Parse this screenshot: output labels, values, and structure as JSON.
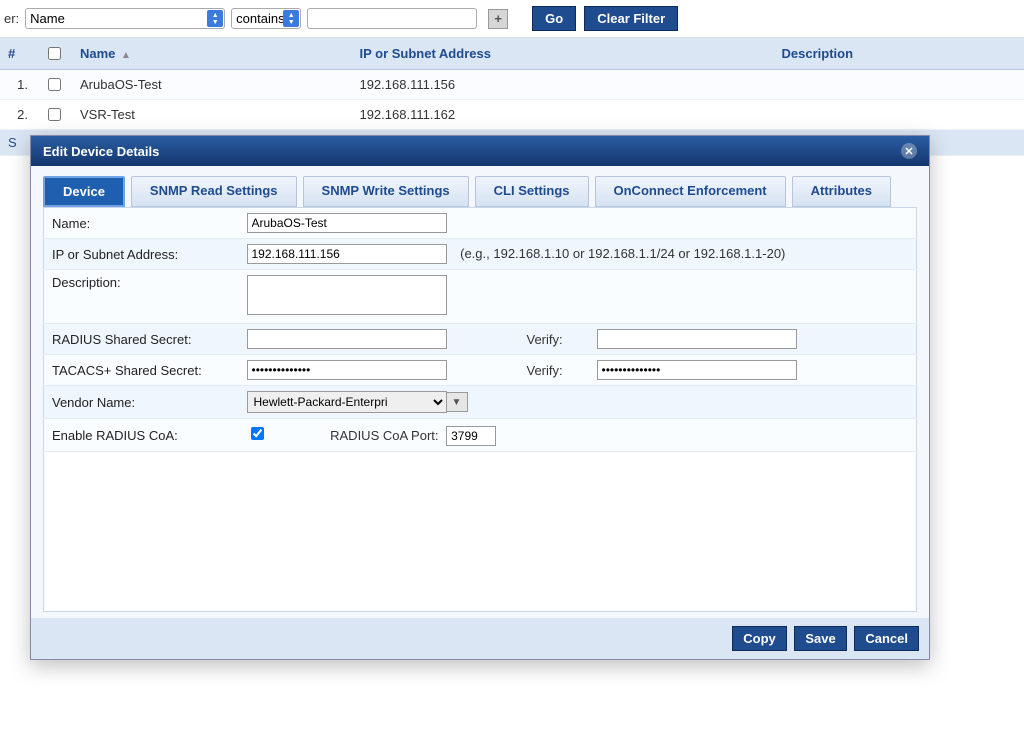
{
  "filter": {
    "label": "er:",
    "field_options": [
      "Name"
    ],
    "field_selected": "Name",
    "op_options": [
      "contains"
    ],
    "op_selected": "contains",
    "value": "",
    "go_label": "Go",
    "clear_label": "Clear Filter"
  },
  "table": {
    "headers": {
      "num": "#",
      "name": "Name",
      "ip": "IP or Subnet Address",
      "desc": "Description"
    },
    "rows": [
      {
        "num": "1.",
        "name": "ArubaOS-Test",
        "ip": "192.168.111.156",
        "desc": ""
      },
      {
        "num": "2.",
        "name": "VSR-Test",
        "ip": "192.168.111.162",
        "desc": ""
      }
    ],
    "footer_left": "S"
  },
  "modal": {
    "title": "Edit Device Details",
    "tabs": [
      "Device",
      "SNMP Read Settings",
      "SNMP Write Settings",
      "CLI Settings",
      "OnConnect Enforcement",
      "Attributes"
    ],
    "active_tab": 0,
    "labels": {
      "name": "Name:",
      "ip": "IP or Subnet Address:",
      "desc": "Description:",
      "radius_secret": "RADIUS Shared Secret:",
      "tacacs_secret": "TACACS+ Shared Secret:",
      "verify": "Verify:",
      "vendor": "Vendor Name:",
      "enable_coa": "Enable RADIUS CoA:",
      "coa_port": "RADIUS CoA Port:"
    },
    "values": {
      "name": "ArubaOS-Test",
      "ip": "192.168.111.156",
      "ip_hint": "(e.g., 192.168.1.10 or 192.168.1.1/24 or 192.168.1.1-20)",
      "desc": "",
      "radius_secret": "",
      "radius_verify": "",
      "tacacs_secret": "••••••••••••••",
      "tacacs_verify": "••••••••••••••",
      "vendor": "Hewlett-Packard-Enterpri",
      "enable_coa": true,
      "coa_port": "3799"
    },
    "buttons": {
      "copy": "Copy",
      "save": "Save",
      "cancel": "Cancel"
    }
  }
}
